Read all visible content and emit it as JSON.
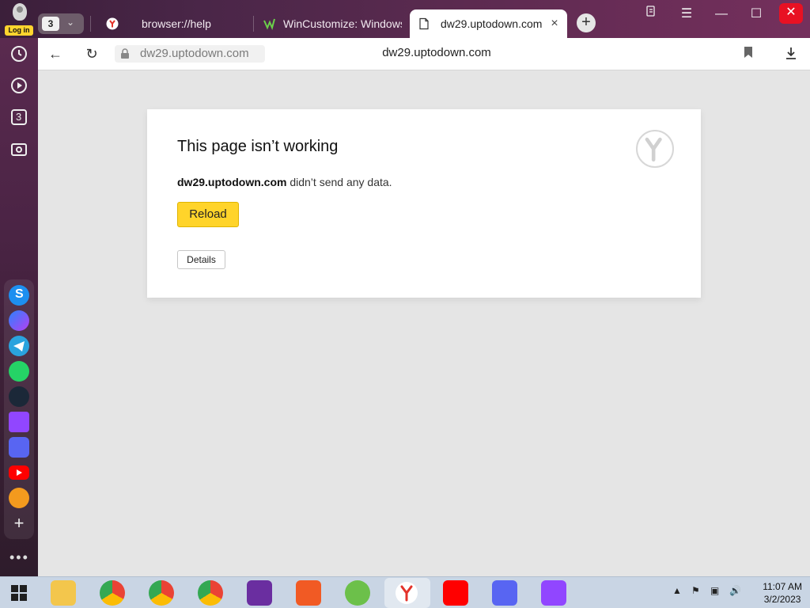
{
  "profile": {
    "login_label": "Log in"
  },
  "tabs": {
    "count": "3",
    "items": [
      {
        "title": "browser://help",
        "favicon": "yandex-icon"
      },
      {
        "title": "WinCustomize: Windows",
        "favicon": "wincustomize-icon"
      },
      {
        "title": "dw29.uptodown.com",
        "favicon": "page-icon"
      }
    ]
  },
  "navbar": {
    "host_pill": "dw29.uptodown.com",
    "center_title": "dw29.uptodown.com"
  },
  "error": {
    "title": "This page isn’t working",
    "host": "dw29.uptodown.com",
    "message": " didn’t send any data.",
    "reload_label": "Reload",
    "details_label": "Details"
  },
  "sidebar": {
    "counter": "3"
  },
  "taskbar": {
    "time": "11:07 AM",
    "date": "3/2/2023"
  },
  "colors": {
    "accent_yellow": "#ffd42a",
    "close_red": "#e81123"
  }
}
